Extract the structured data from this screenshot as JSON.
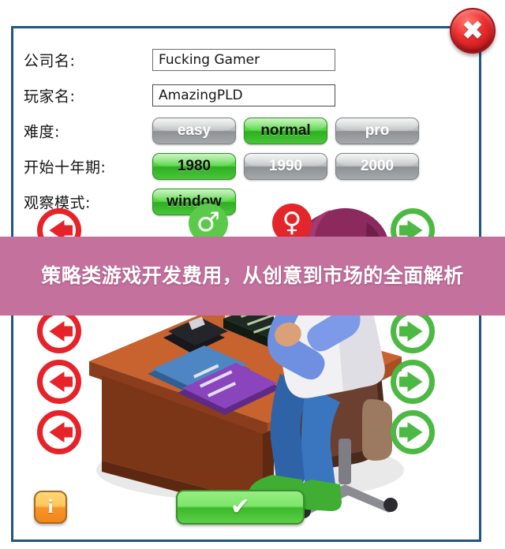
{
  "window": {
    "title": "",
    "close_button_label": "✖",
    "close_icon": "close-circle-icon"
  },
  "form": {
    "rows": [
      {
        "label": "公司名:",
        "type": "text",
        "value": "Fucking Gamer",
        "placeholder": "",
        "name": "company-name"
      },
      {
        "label": "玩家名:",
        "type": "text",
        "value": "AmazingPLD",
        "placeholder": "",
        "name": "player-name",
        "focused": true
      },
      {
        "label": "难度:",
        "type": "segmented",
        "name": "difficulty",
        "options": [
          {
            "label": "easy",
            "selected": false
          },
          {
            "label": "normal",
            "selected": true
          },
          {
            "label": "pro",
            "selected": false
          }
        ]
      },
      {
        "label": "开始十年期:",
        "type": "segmented",
        "name": "start-decade",
        "options": [
          {
            "label": "1980",
            "selected": true
          },
          {
            "label": "1990",
            "selected": false
          },
          {
            "label": "2000",
            "selected": false
          }
        ]
      },
      {
        "label": "观察模式:",
        "type": "segmented",
        "name": "view-mode",
        "options": [
          {
            "label": "window",
            "selected": true
          }
        ]
      }
    ]
  },
  "avatar_picker": {
    "gender": [
      {
        "icon": "male-symbol-icon",
        "glyph": "♂",
        "color": "#5bc94a",
        "selected": true
      },
      {
        "icon": "female-symbol-icon",
        "glyph": "♀",
        "color": "#e3262c",
        "selected": false
      }
    ],
    "left_arrows_count": 5,
    "right_arrows_count": 5,
    "left_arrow_icon": "arrow-left-circle-icon",
    "right_arrow_icon": "arrow-right-circle-icon",
    "left_arrow_color": "#e62329",
    "right_arrow_color": "#4cb944"
  },
  "bottom_bar": {
    "info_label": "i",
    "info_icon": "info-icon",
    "confirm_label": "✔",
    "confirm_icon": "checkmark-icon"
  },
  "overlay": {
    "text": "策略类游戏开发费用，从创意到市场的全面解析",
    "background_color": "#c4719e",
    "text_color": "#ffffff"
  },
  "theme": {
    "window_border": "#21567f",
    "window_background": "#ffffff",
    "selected_green": "#4fd33d",
    "unselected_gray": "#b9bbbc",
    "close_red": "#ef3030",
    "info_orange": "#f79528",
    "confirm_green": "#7ee669"
  }
}
